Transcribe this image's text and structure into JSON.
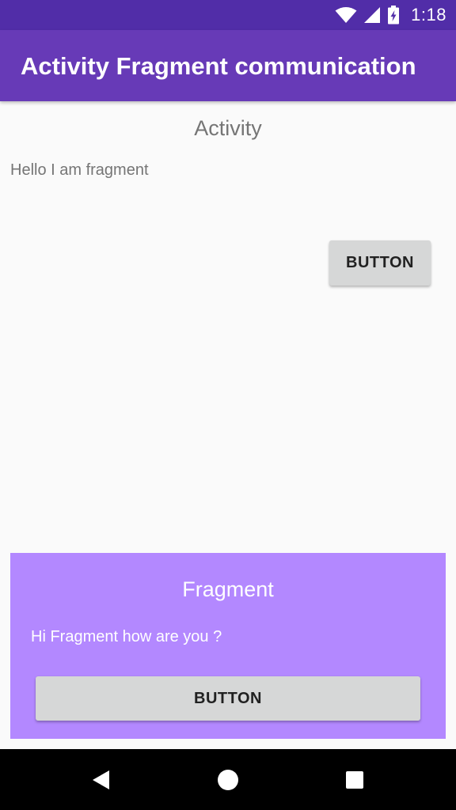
{
  "status_bar": {
    "time": "1:18",
    "icons": [
      "wifi-icon",
      "cell-signal-icon",
      "battery-charging-icon"
    ]
  },
  "app_bar": {
    "title": "Activity Fragment communication",
    "color": "#673ab7"
  },
  "activity": {
    "heading": "Activity",
    "text": "Hello I am fragment",
    "button_label": "BUTTON"
  },
  "fragment": {
    "heading": "Fragment",
    "text": "Hi Fragment how are you ?",
    "button_label": "BUTTON",
    "background": "#b388ff"
  },
  "nav_bar": {
    "icons": [
      "back-icon",
      "home-icon",
      "recents-icon"
    ]
  }
}
